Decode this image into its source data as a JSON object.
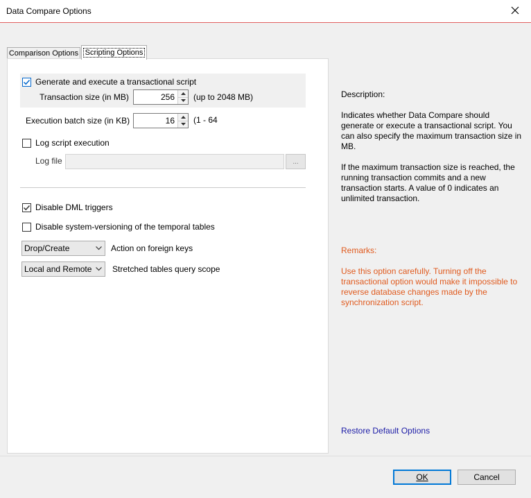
{
  "window": {
    "title": "Data Compare Options",
    "close_icon": "close-icon"
  },
  "tabs": [
    {
      "label": "Comparison Options",
      "active": false
    },
    {
      "label": "Scripting Options",
      "active": true
    }
  ],
  "options": {
    "generate_transactional": {
      "label": "Generate and execute a transactional script",
      "checked": true
    },
    "transaction_size": {
      "label": "Transaction size (in MB)",
      "value": "256",
      "hint": "(up to 2048 MB)"
    },
    "batch_size": {
      "label": "Execution batch size (in KB)",
      "value": "16",
      "hint": "(1 - 64"
    },
    "log_script": {
      "label": "Log script execution",
      "checked": false
    },
    "log_file": {
      "label": "Log file",
      "value": "",
      "browse_label": "..."
    },
    "disable_dml": {
      "label": "Disable DML triggers",
      "checked": true
    },
    "disable_versioning": {
      "label": "Disable system-versioning of the temporal tables",
      "checked": false
    },
    "foreign_keys": {
      "selected": "Drop/Create",
      "label": "Action on foreign keys"
    },
    "stretched_scope": {
      "selected": "Local and Remote",
      "label": "Stretched tables query scope"
    }
  },
  "description": {
    "title": "Description:",
    "para1": "Indicates whether Data Compare should generate or execute a transactional script. You can also specify the maximum transaction size in MB.",
    "para2": "If the maximum transaction size is reached, the running transaction commits and a new transaction starts. A value of 0 indicates an unlimited transaction."
  },
  "remarks": {
    "title": "Remarks:",
    "body": "Use this option carefully. Turning off the transactional option would make it impossible to reverse database changes made by the synchronization script.",
    "color": "#e05a1e"
  },
  "restore_link": "Restore Default Options",
  "buttons": {
    "ok": "OK",
    "cancel": "Cancel"
  }
}
